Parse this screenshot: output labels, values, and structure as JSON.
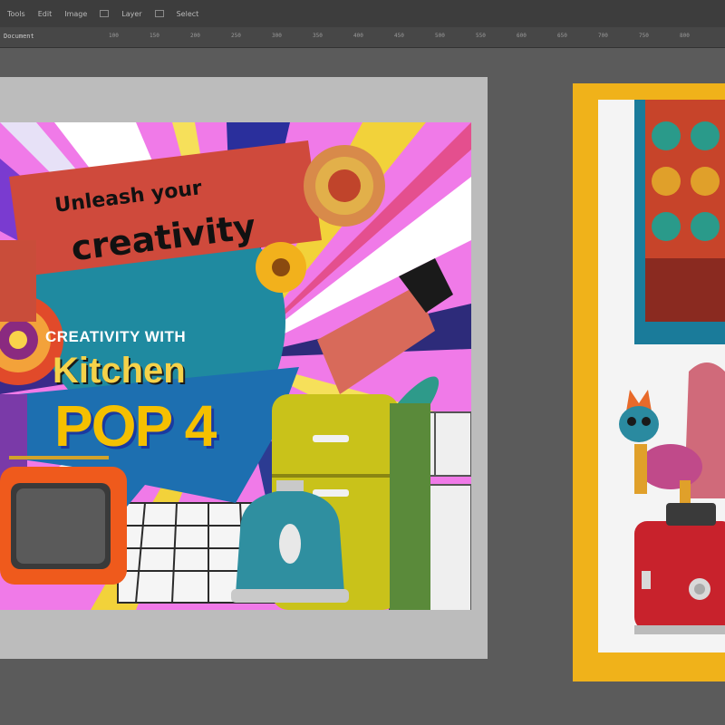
{
  "menubar": {
    "items": [
      "Tools",
      "Edit",
      "Image",
      "Layer",
      "Select"
    ]
  },
  "ruler": {
    "label": "Document",
    "ticks": [
      "100",
      "150",
      "200",
      "250",
      "300",
      "350",
      "400",
      "450",
      "500",
      "550",
      "600",
      "650",
      "700",
      "750",
      "800"
    ]
  },
  "artwork": {
    "banner_line1": "Unleash your",
    "banner_line2": "creativity",
    "subtitle": "CREATIVITY WITH",
    "title_word": "Kitchen",
    "title_pop": "POP 4"
  },
  "colors": {
    "pasteboard": "#5b5b5b",
    "magenta": "#f07ae8",
    "banner_red": "#cf4a3c",
    "pop_yellow": "#f5c000",
    "teal": "#1f8aa0",
    "fridge_yellow": "#c9c21a",
    "right_frame": "#f0b21a",
    "toaster_red": "#c8222c"
  }
}
